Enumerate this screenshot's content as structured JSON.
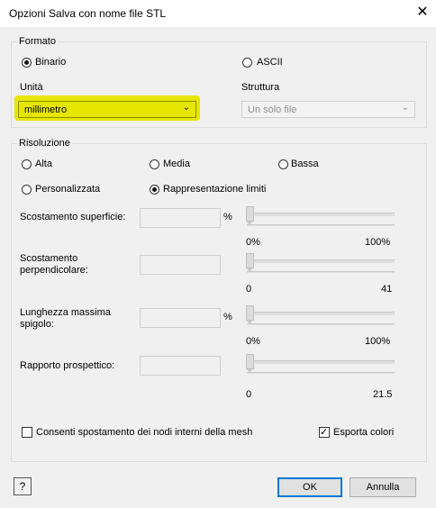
{
  "window": {
    "title": "Opzioni Salva con nome file STL",
    "close_icon": "close-icon"
  },
  "formato": {
    "label": "Formato",
    "binario": {
      "label": "Binario",
      "selected": true
    },
    "ascii": {
      "label": "ASCII",
      "selected": false
    }
  },
  "unita": {
    "label": "Unità",
    "value": "millimetro",
    "highlight_color": "#e6e600"
  },
  "struttura": {
    "label": "Struttura",
    "value": "Un solo file",
    "disabled": true
  },
  "risoluzione": {
    "label": "Risoluzione",
    "options": [
      {
        "label": "Alta",
        "selected": false
      },
      {
        "label": "Media",
        "selected": false
      },
      {
        "label": "Bassa",
        "selected": false
      },
      {
        "label": "Personalizzata",
        "selected": false
      },
      {
        "label": "Rappresentazione limiti",
        "selected": true
      }
    ]
  },
  "params": [
    {
      "label": "Scostamento superficie:",
      "unit": "%",
      "min": "0%",
      "max": "100%"
    },
    {
      "label": "Scostamento perpendicolare:",
      "unit": "",
      "min": "0",
      "max": "41"
    },
    {
      "label": "Lunghezza massima spigolo:",
      "unit": "%",
      "min": "0%",
      "max": "100%"
    },
    {
      "label": "Rapporto prospettico:",
      "unit": "",
      "min": "0",
      "max": "21.5"
    }
  ],
  "options": {
    "mesh": {
      "label": "Consenti spostamento dei nodi interni della mesh",
      "checked": false
    },
    "colori": {
      "label": "Esporta colori",
      "checked": true
    }
  },
  "buttons": {
    "ok": "OK",
    "cancel": "Annulla",
    "help_icon": "help-icon",
    "help_glyph": "?"
  },
  "colors": {
    "default_button_border": "#0078d7"
  }
}
